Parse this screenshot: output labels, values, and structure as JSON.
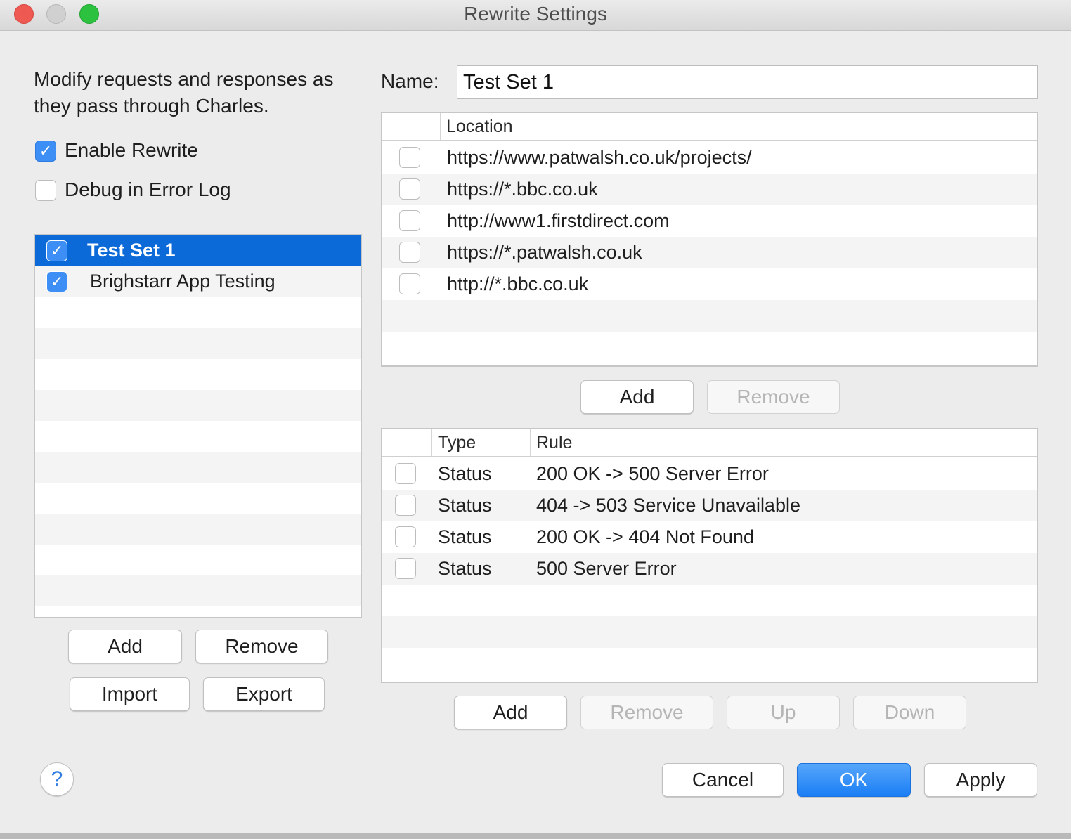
{
  "window": {
    "title": "Rewrite Settings"
  },
  "intro": {
    "text": "Modify requests and responses as they pass through Charles."
  },
  "options": [
    {
      "label": "Enable Rewrite",
      "checked": true
    },
    {
      "label": "Debug in Error Log",
      "checked": false
    }
  ],
  "sets": [
    {
      "label": "Test Set 1",
      "checked": true,
      "selected": true
    },
    {
      "label": "Brighstarr App Testing",
      "checked": true,
      "selected": false
    }
  ],
  "set_buttons": {
    "add": "Add",
    "remove": "Remove",
    "import": "Import",
    "export": "Export"
  },
  "name": {
    "label": "Name:",
    "value": "Test Set 1"
  },
  "locations": {
    "header": "Location",
    "rows": [
      {
        "checked": false,
        "location": "https://www.patwalsh.co.uk/projects/"
      },
      {
        "checked": false,
        "location": "https://*.bbc.co.uk"
      },
      {
        "checked": false,
        "location": "http://www1.firstdirect.com"
      },
      {
        "checked": false,
        "location": "https://*.patwalsh.co.uk"
      },
      {
        "checked": false,
        "location": "http://*.bbc.co.uk"
      }
    ],
    "add_label": "Add",
    "remove_label": "Remove"
  },
  "rules": {
    "headers": {
      "type": "Type",
      "rule": "Rule"
    },
    "rows": [
      {
        "checked": false,
        "type": "Status",
        "rule": "200 OK -> 500 Server Error"
      },
      {
        "checked": false,
        "type": "Status",
        "rule": "404 -> 503 Service Unavailable"
      },
      {
        "checked": false,
        "type": "Status",
        "rule": "200 OK -> 404 Not Found"
      },
      {
        "checked": false,
        "type": "Status",
        "rule": "500 Server Error"
      }
    ],
    "add_label": "Add",
    "remove_label": "Remove",
    "up_label": "Up",
    "down_label": "Down"
  },
  "footer": {
    "help": "?",
    "cancel": "Cancel",
    "ok": "OK",
    "apply": "Apply"
  },
  "colors": {
    "accent": "#1b7ef5",
    "selection": "#0b6ad8",
    "close": "#ee5a52",
    "zoom": "#2cc23f"
  }
}
